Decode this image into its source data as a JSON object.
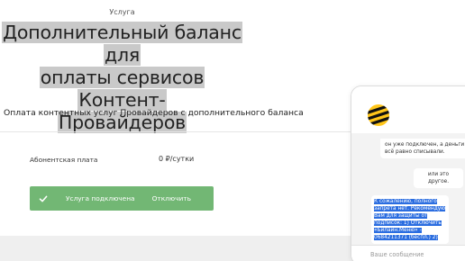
{
  "service": {
    "eyebrow": "Услуга",
    "title_lines": [
      "Дополнительный баланс для",
      "оплаты сервисов Контент-",
      "Провайдеров"
    ],
    "description": "Оплата контентных услуг Провайдеров с дополнительного баланса"
  },
  "fee": {
    "label": "Абонентская плата",
    "value": "0 ₽/сутки"
  },
  "status": {
    "text": "Услуга подключена",
    "action": "Отключить",
    "color": "#72b774"
  },
  "chat": {
    "messages": [
      "он уже подключен, а деньги всё равно списывали.",
      "или это другое.",
      "К сожалению, полного запрета нет. Рекомендую Вам для защиты от подписок: 1) Отключить «Билайн.Меню» - 0684211371 (беспл.) 2)"
    ],
    "input_placeholder": "Ваше сообщение",
    "logo_icon": "beeline-bee-icon",
    "brand_yellow": "#ffc61a"
  }
}
